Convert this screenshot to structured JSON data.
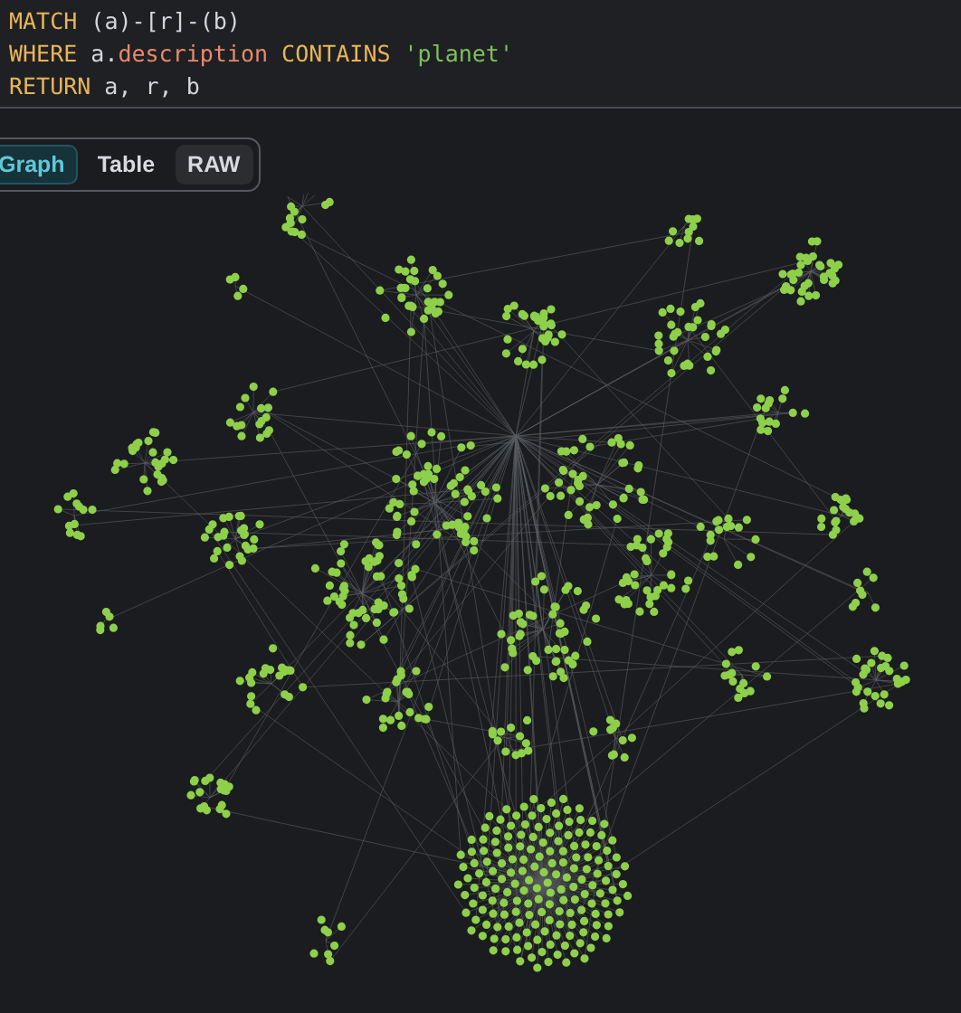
{
  "query": {
    "lines": [
      [
        {
          "kind": "keyword",
          "text": "MATCH"
        },
        {
          "kind": "plain",
          "text": " (a)-[r]-(b)"
        }
      ],
      [
        {
          "kind": "keyword",
          "text": "WHERE"
        },
        {
          "kind": "plain",
          "text": " a."
        },
        {
          "kind": "property",
          "text": "description"
        },
        {
          "kind": "keyword",
          "text": " CONTAINS"
        },
        {
          "kind": "string",
          "text": " 'planet'"
        }
      ],
      [
        {
          "kind": "keyword",
          "text": "RETURN"
        },
        {
          "kind": "plain",
          "text": " a, r, b"
        }
      ]
    ]
  },
  "view_tabs": [
    {
      "label": "Graph",
      "selected": true,
      "hovered": false
    },
    {
      "label": "Table",
      "selected": false,
      "hovered": false
    },
    {
      "label": "RAW",
      "selected": false,
      "hovered": true
    }
  ]
}
